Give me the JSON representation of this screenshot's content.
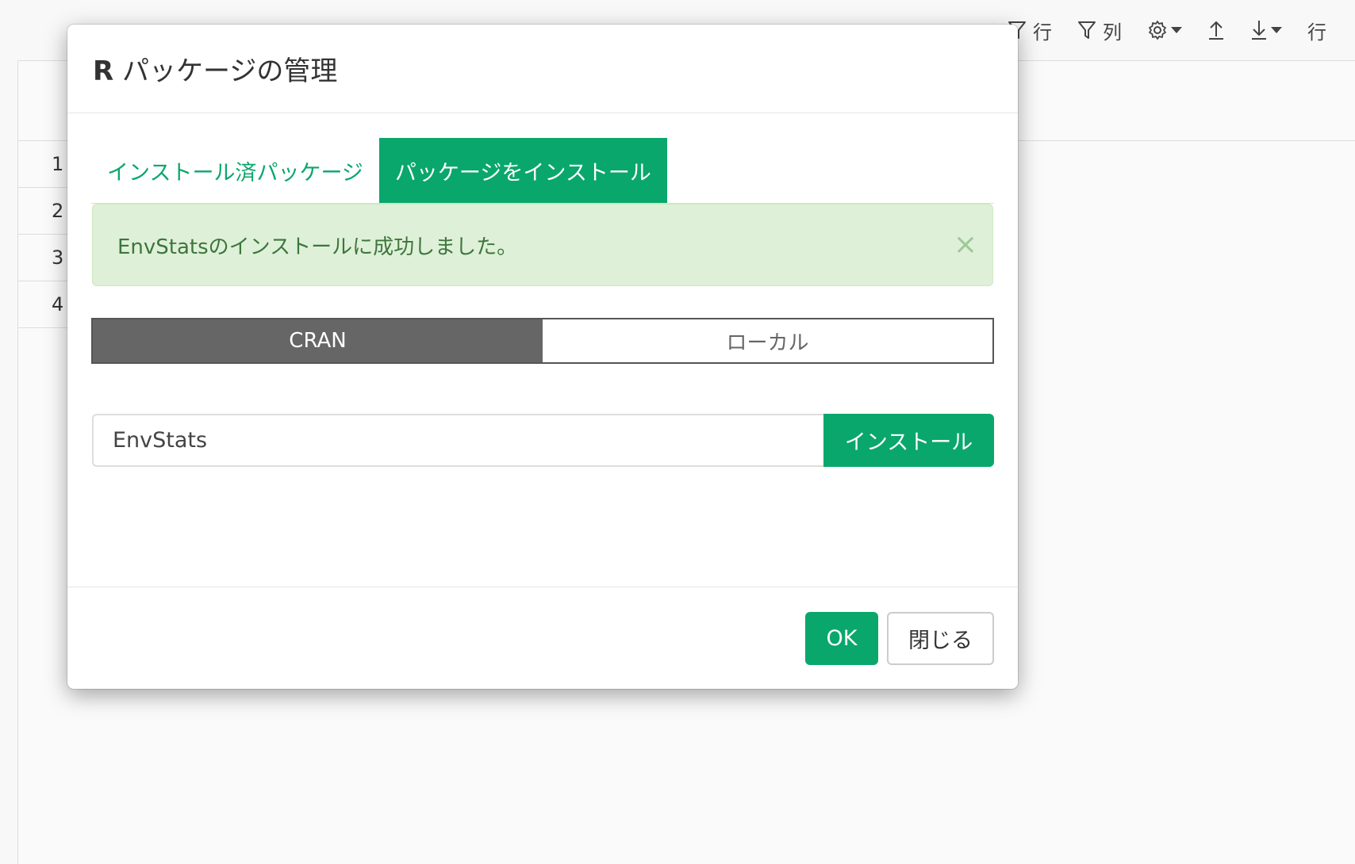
{
  "toolbar": {
    "filter_rows_label": "行",
    "filter_cols_label": "列",
    "overflow_label": "行",
    "icons": [
      "filter-icon",
      "filter-icon",
      "gear-icon",
      "upload-icon",
      "download-icon"
    ]
  },
  "grid": {
    "row_numbers": [
      "1",
      "2",
      "3",
      "4"
    ]
  },
  "modal": {
    "title_bold": "R",
    "title_rest": " パッケージの管理",
    "tabs": [
      {
        "label": "インストール済パッケージ",
        "active": false
      },
      {
        "label": "パッケージをインストール",
        "active": true
      }
    ],
    "alert": {
      "message": "EnvStatsのインストールに成功しました。",
      "close_symbol": "×"
    },
    "source_toggle": {
      "options": [
        "CRAN",
        "ローカル"
      ],
      "selected": "CRAN"
    },
    "package_input": {
      "value": "EnvStats"
    },
    "install_button": "インストール",
    "footer": {
      "ok_label": "OK",
      "close_label": "閉じる"
    }
  },
  "colors": {
    "accent": "#0aa76c",
    "alert_bg": "#dff0d8",
    "alert_text": "#3c763d",
    "toggle_selected": "#666666"
  }
}
